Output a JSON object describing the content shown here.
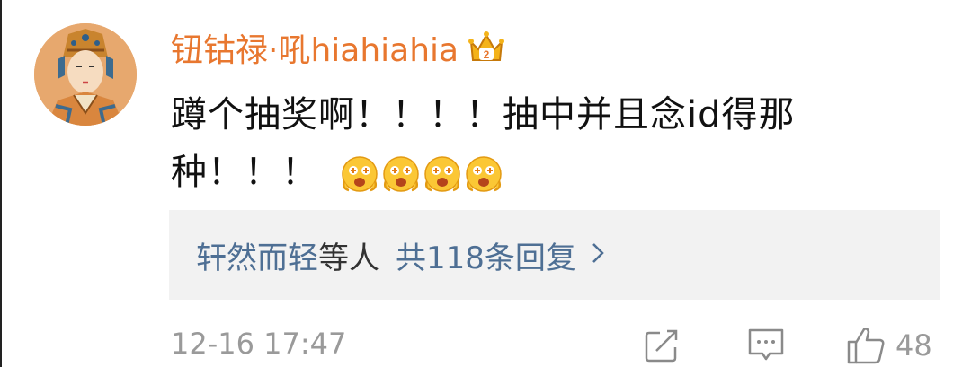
{
  "comment": {
    "username": "钮钴禄·吼hiahiahia",
    "text_line1": "蹲个抽奖啊！！！！抽中并且念id得那",
    "text_line2": "种！！！",
    "emoji_icon": "excited-face-emoji",
    "emoji_count": 4,
    "badge_icon": "crown-badge-icon"
  },
  "replies": {
    "names": "轩然而轻",
    "suffix": "等人",
    "count_label": "共118条回复"
  },
  "footer": {
    "timestamp": "12-16 17:47",
    "like_count": "48"
  },
  "colors": {
    "username": "#e8772f",
    "reply_link": "#4e6f94",
    "muted": "#9a9a9a",
    "reply_bg": "#f2f2f2"
  }
}
